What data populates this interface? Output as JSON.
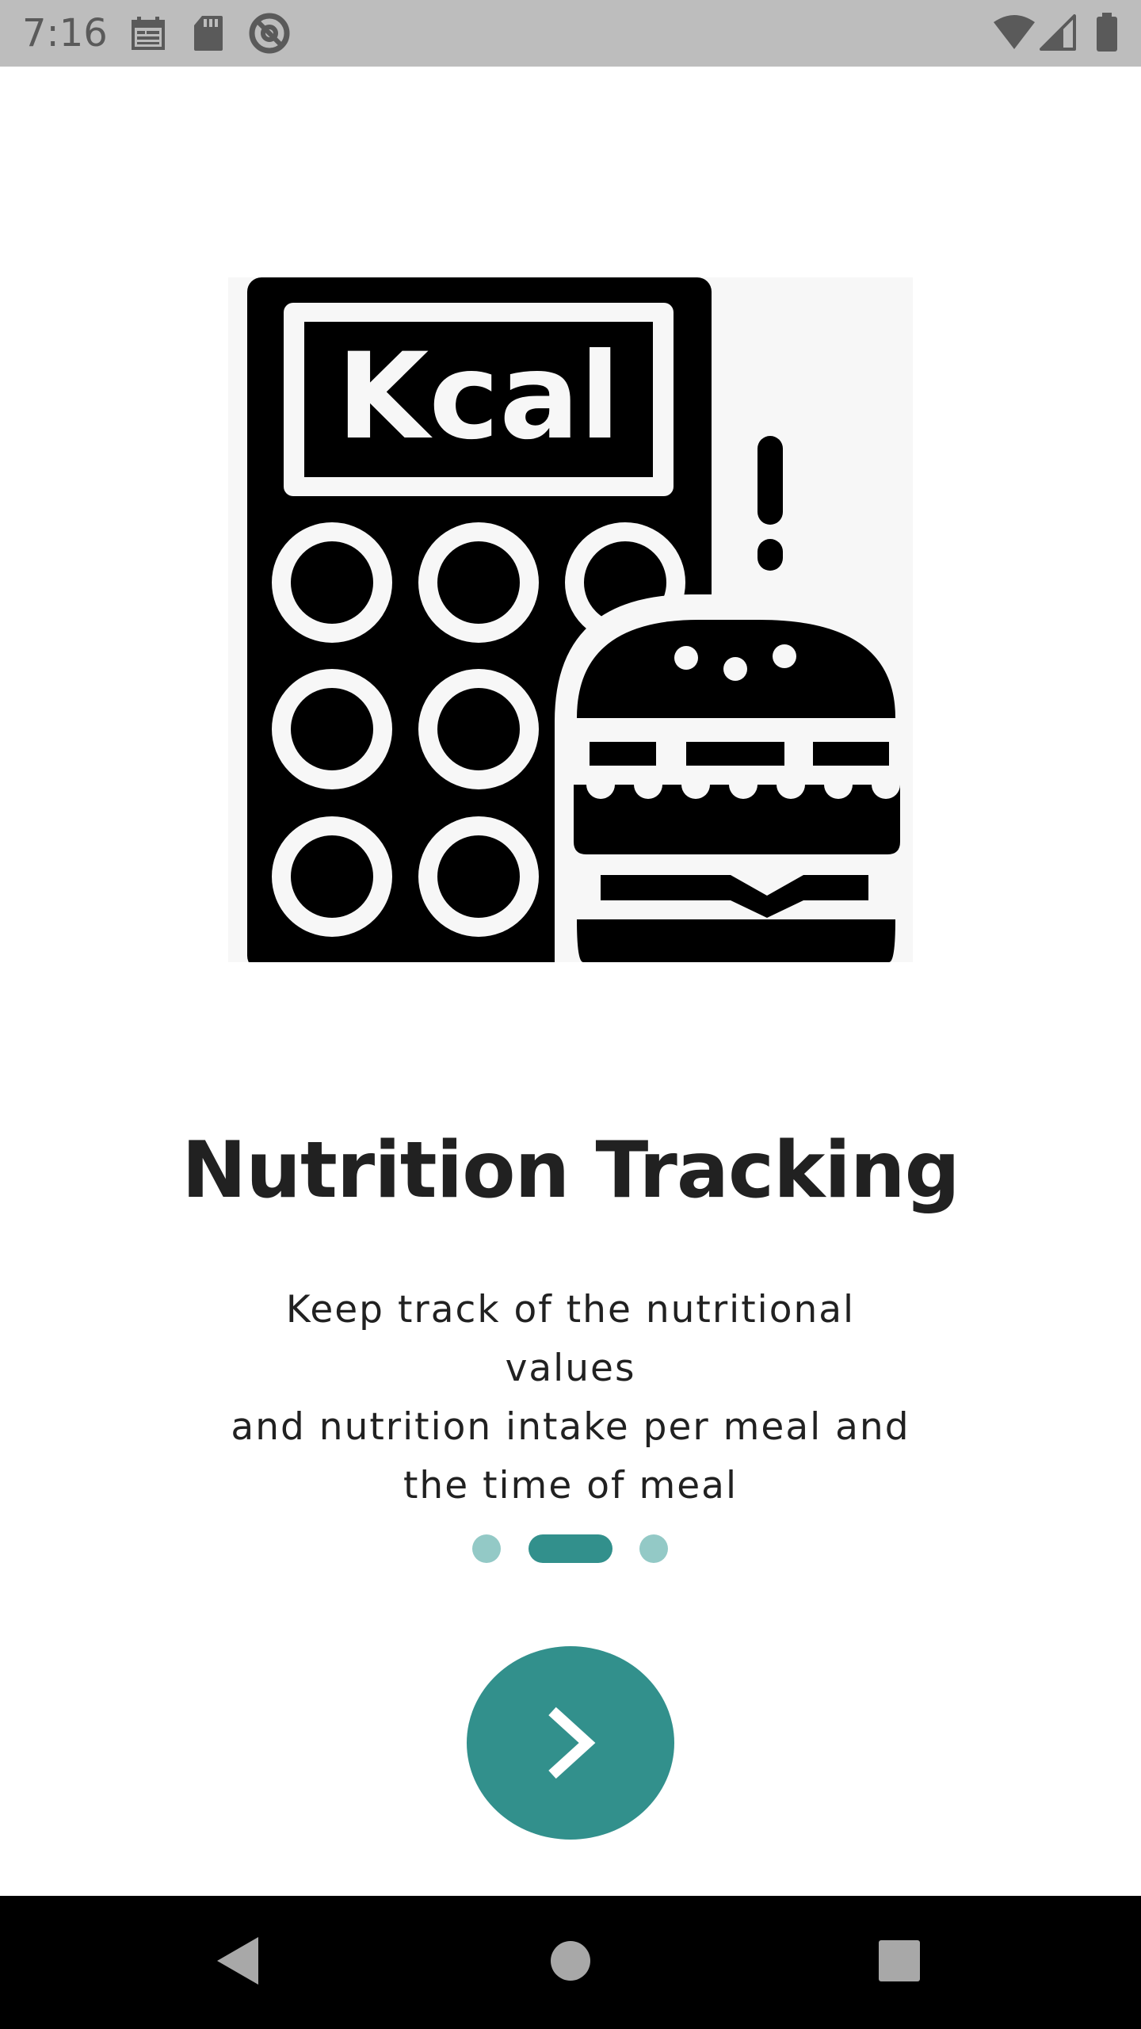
{
  "status_bar": {
    "time": "7:16",
    "left_icons": [
      "calendar-icon",
      "sd-card-icon",
      "at-sign-icon"
    ],
    "right_icons": [
      "wifi-icon",
      "cell-signal-icon",
      "battery-icon"
    ]
  },
  "onboarding": {
    "illustration": {
      "icon": "calorie-calculator-burger-icon",
      "label": "Kcal"
    },
    "title": "Nutrition Tracking",
    "description": [
      "Keep track of the nutritional values",
      "and nutrition intake per meal and",
      "the time of meal"
    ],
    "page_indicator": {
      "total": 3,
      "active_index": 1
    },
    "next_button": {
      "icon": "chevron-right-icon"
    }
  },
  "navigation_bar": {
    "buttons": [
      "back-icon",
      "home-icon",
      "recents-icon"
    ]
  },
  "colors": {
    "accent": "#32908c",
    "indicator_inactive": "#93c9c6",
    "status_bar": "#bdbdbd",
    "text": "#212121"
  }
}
